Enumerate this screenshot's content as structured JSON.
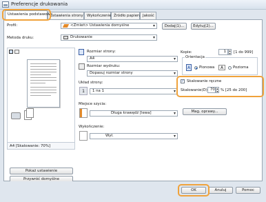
{
  "window": {
    "title": "Preferencje drukowania"
  },
  "tabs": [
    {
      "label": "Ustawienia podstawowe",
      "active": true
    },
    {
      "label": "ustawienia strony"
    },
    {
      "label": "Wykończenie"
    },
    {
      "label": "Źródło papieru"
    },
    {
      "label": "Jakość"
    }
  ],
  "profile": {
    "label": "Profil:",
    "value": "<Zmień> Ustawienia domyślne",
    "add_label": "Dodaj(1)...",
    "edit_label": "Edytuj(2)..."
  },
  "output": {
    "label": "Metoda druku:",
    "value": "Drukowanie"
  },
  "preview": {
    "caption": "A4 [Skalowanie: 70%]"
  },
  "left_buttons": {
    "show_settings": "Pokaż ustawienie",
    "restore_defaults": "Przywróć domyślne"
  },
  "page": {
    "size_label": "Rozmiar strony:",
    "size_value": "A4",
    "output_size_label": "Rozmiar wydruku:",
    "output_size_value": "Dopasuj rozmiar strony",
    "layout_label": "Układ strony:",
    "layout_value": "1 na 1",
    "layout_count": "1",
    "binding_label": "Miejsce szycia:",
    "binding_value": "Długa krawędź [lewa]",
    "finishing_label": "Wykończenie:",
    "finishing_value": "Wył."
  },
  "copies": {
    "label": "Kopie:",
    "value": "1",
    "range": "[1 do 999]"
  },
  "orientation": {
    "label": "Orientacja",
    "portrait": "Pionowa",
    "landscape": "Pozioma",
    "selected": "portrait"
  },
  "scaling": {
    "checkbox_label": "Skalowanie ręczne",
    "checked": true,
    "field_label": "Skalowanie(D):",
    "value": "70",
    "range": "% [25 do 200]"
  },
  "watermark_button": "Mag. oprawy...",
  "footer": {
    "ok": "OK",
    "cancel": "Anuluj",
    "help": "Pomoc"
  },
  "accent_color": "#f0a23a"
}
